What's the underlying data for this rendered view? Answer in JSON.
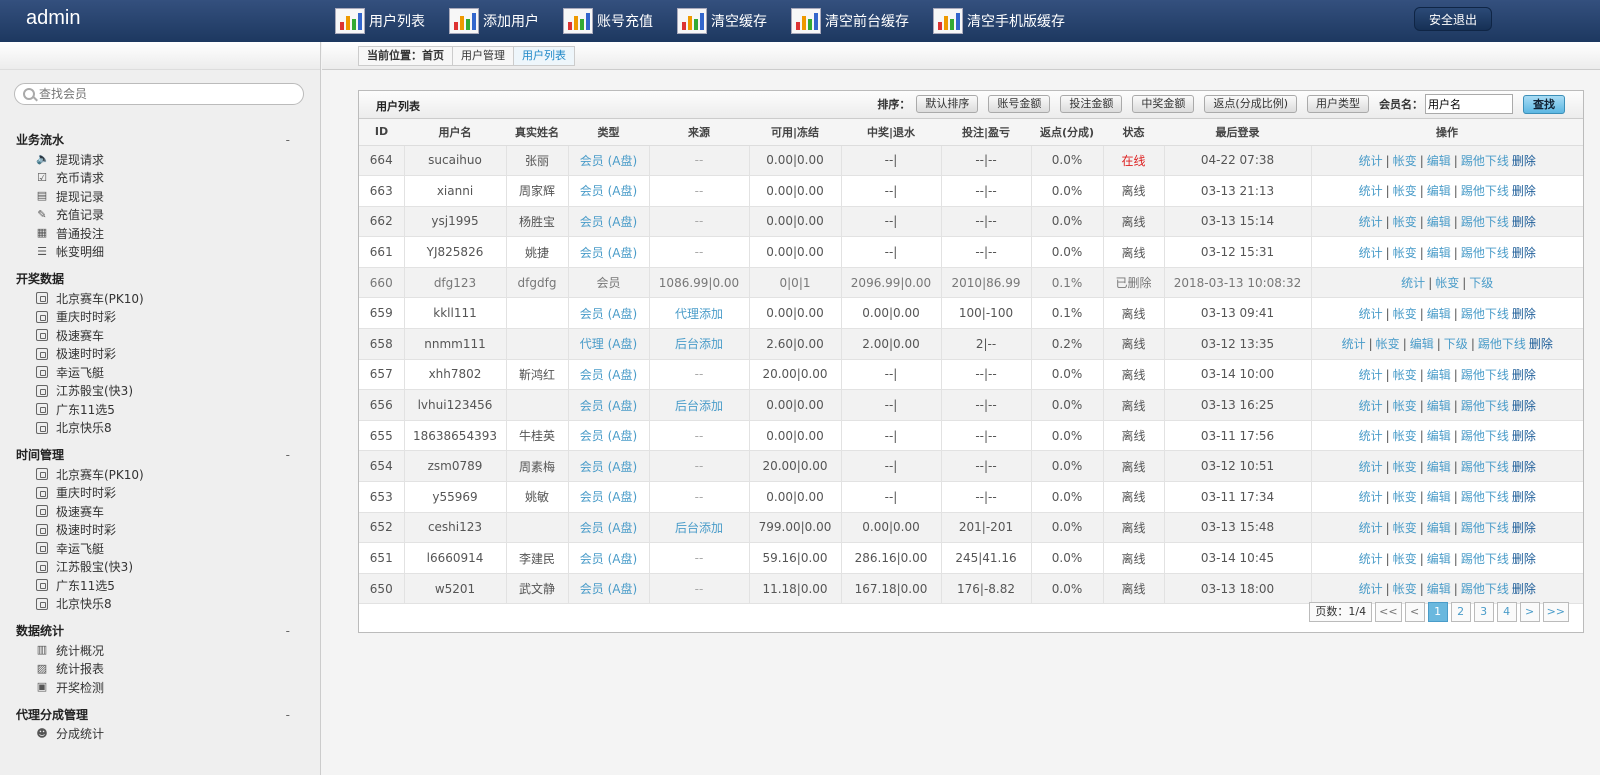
{
  "header": {
    "brand": "admin",
    "nav": [
      "用户列表",
      "添加用户",
      "账号充值",
      "清空缓存",
      "清空前台缓存",
      "清空手机版缓存"
    ],
    "logout": "安全退出"
  },
  "sidebar": {
    "search_placeholder": "查找会员",
    "groups": [
      {
        "title": "业务流水",
        "collapse": "-",
        "items": [
          {
            "label": "提现请求",
            "icon": "speaker-icon"
          },
          {
            "label": "充币请求",
            "icon": "check-icon"
          },
          {
            "label": "提现记录",
            "icon": "wallet-icon"
          },
          {
            "label": "充值记录",
            "icon": "pen-icon"
          },
          {
            "label": "普通投注",
            "icon": "book-icon"
          },
          {
            "label": "帐变明细",
            "icon": "list-icon"
          }
        ]
      },
      {
        "title": "开奖数据",
        "collapse": "",
        "items": [
          {
            "label": "北京赛车(PK10)"
          },
          {
            "label": "重庆时时彩"
          },
          {
            "label": "极速赛车"
          },
          {
            "label": "极速时时彩"
          },
          {
            "label": "幸运飞艇"
          },
          {
            "label": "江苏骰宝(快3)"
          },
          {
            "label": "广东11选5"
          },
          {
            "label": "北京快乐8"
          }
        ]
      },
      {
        "title": "时间管理",
        "collapse": "-",
        "items": [
          {
            "label": "北京赛车(PK10)"
          },
          {
            "label": "重庆时时彩"
          },
          {
            "label": "极速赛车"
          },
          {
            "label": "极速时时彩"
          },
          {
            "label": "幸运飞艇"
          },
          {
            "label": "江苏骰宝(快3)"
          },
          {
            "label": "广东11选5"
          },
          {
            "label": "北京快乐8"
          }
        ]
      },
      {
        "title": "数据统计",
        "collapse": "-",
        "items": [
          {
            "label": "统计概况",
            "icon": "chart-icon"
          },
          {
            "label": "统计报表",
            "icon": "report-icon"
          },
          {
            "label": "开奖检测",
            "icon": "monitor-icon"
          }
        ]
      },
      {
        "title": "代理分成管理",
        "collapse": "-",
        "items": [
          {
            "label": "分成统计",
            "icon": "users-icon"
          }
        ]
      }
    ]
  },
  "breadcrumb": [
    "当前位置：首页",
    "用户管理",
    "用户列表"
  ],
  "panel": {
    "title": "用户列表",
    "sort_label": "排序：",
    "sort_buttons": [
      "默认排序",
      "账号金额",
      "投注金额",
      "中奖金额",
      "返点(分成比例)",
      "用户类型"
    ],
    "member_label": "会员名：",
    "member_value": "用户名",
    "query": "查找"
  },
  "table": {
    "columns": [
      "ID",
      "用户名",
      "真实姓名",
      "类型",
      "来源",
      "可用|冻结",
      "中奖|退水",
      "投注|盈亏",
      "返点(分成)",
      "状态",
      "最后登录",
      "操作"
    ],
    "rows": [
      {
        "id": "664",
        "user": "sucaihuo",
        "name": "张丽",
        "type": "会员 (A盘)",
        "src": "--",
        "bal": "0.00|0.00",
        "win": "--|",
        "bet": "--|--",
        "rebate": "0.0%",
        "status": "在线",
        "login": "04-22 07:38",
        "ops": [
          "统计",
          "帐变",
          "编辑",
          "踢他下线"
        ],
        "del": "删除"
      },
      {
        "id": "663",
        "user": "xianni",
        "name": "周家辉",
        "type": "会员 (A盘)",
        "src": "--",
        "bal": "0.00|0.00",
        "win": "--|",
        "bet": "--|--",
        "rebate": "0.0%",
        "status": "离线",
        "login": "03-13 21:13",
        "ops": [
          "统计",
          "帐变",
          "编辑",
          "踢他下线"
        ],
        "del": "删除"
      },
      {
        "id": "662",
        "user": "ysj1995",
        "name": "杨胜宝",
        "type": "会员 (A盘)",
        "src": "--",
        "bal": "0.00|0.00",
        "win": "--|",
        "bet": "--|--",
        "rebate": "0.0%",
        "status": "离线",
        "login": "03-13 15:14",
        "ops": [
          "统计",
          "帐变",
          "编辑",
          "踢他下线"
        ],
        "del": "删除"
      },
      {
        "id": "661",
        "user": "YJ825826",
        "name": "姚捷",
        "type": "会员 (A盘)",
        "src": "--",
        "bal": "0.00|0.00",
        "win": "--|",
        "bet": "--|--",
        "rebate": "0.0%",
        "status": "离线",
        "login": "03-12 15:31",
        "ops": [
          "统计",
          "帐变",
          "编辑",
          "踢他下线"
        ],
        "del": "删除"
      },
      {
        "id": "660",
        "user": "dfg123",
        "name": "dfgdfg",
        "type": "会员",
        "src": "1086.99|0.00",
        "bal": "0|0|1",
        "win": "2096.99|0.00",
        "bet": "2010|86.99",
        "rebate": "0.1%",
        "status": "已删除",
        "login": "2018-03-13 10:08:32",
        "ops": [
          "统计",
          "帐变",
          "下级"
        ],
        "del": "",
        "deleted": true
      },
      {
        "id": "659",
        "user": "kkll111",
        "name": "",
        "type": "会员 (A盘)",
        "src": "代理添加",
        "bal": "0.00|0.00",
        "win": "0.00|0.00",
        "bet": "100|-100",
        "rebate": "0.1%",
        "status": "离线",
        "login": "03-13 09:41",
        "ops": [
          "统计",
          "帐变",
          "编辑",
          "踢他下线"
        ],
        "del": "删除"
      },
      {
        "id": "658",
        "user": "nnmm111",
        "name": "",
        "type": "代理 (A盘)",
        "src": "后台添加",
        "bal": "2.60|0.00",
        "win": "2.00|0.00",
        "bet": "2|--",
        "rebate": "0.2%",
        "status": "离线",
        "login": "03-12 13:35",
        "ops": [
          "统计",
          "帐变",
          "编辑",
          "下级",
          "踢他下线"
        ],
        "del": "删除"
      },
      {
        "id": "657",
        "user": "xhh7802",
        "name": "靳鸿红",
        "type": "会员 (A盘)",
        "src": "--",
        "bal": "20.00|0.00",
        "win": "--|",
        "bet": "--|--",
        "rebate": "0.0%",
        "status": "离线",
        "login": "03-14 10:00",
        "ops": [
          "统计",
          "帐变",
          "编辑",
          "踢他下线"
        ],
        "del": "删除"
      },
      {
        "id": "656",
        "user": "lvhui123456",
        "name": "",
        "type": "会员 (A盘)",
        "src": "后台添加",
        "bal": "0.00|0.00",
        "win": "--|",
        "bet": "--|--",
        "rebate": "0.0%",
        "status": "离线",
        "login": "03-13 16:25",
        "ops": [
          "统计",
          "帐变",
          "编辑",
          "踢他下线"
        ],
        "del": "删除"
      },
      {
        "id": "655",
        "user": "18638654393",
        "name": "牛桂英",
        "type": "会员 (A盘)",
        "src": "--",
        "bal": "0.00|0.00",
        "win": "--|",
        "bet": "--|--",
        "rebate": "0.0%",
        "status": "离线",
        "login": "03-11 17:56",
        "ops": [
          "统计",
          "帐变",
          "编辑",
          "踢他下线"
        ],
        "del": "删除"
      },
      {
        "id": "654",
        "user": "zsm0789",
        "name": "周素梅",
        "type": "会员 (A盘)",
        "src": "--",
        "bal": "20.00|0.00",
        "win": "--|",
        "bet": "--|--",
        "rebate": "0.0%",
        "status": "离线",
        "login": "03-12 10:51",
        "ops": [
          "统计",
          "帐变",
          "编辑",
          "踢他下线"
        ],
        "del": "删除"
      },
      {
        "id": "653",
        "user": "y55969",
        "name": "姚敏",
        "type": "会员 (A盘)",
        "src": "--",
        "bal": "0.00|0.00",
        "win": "--|",
        "bet": "--|--",
        "rebate": "0.0%",
        "status": "离线",
        "login": "03-11 17:34",
        "ops": [
          "统计",
          "帐变",
          "编辑",
          "踢他下线"
        ],
        "del": "删除"
      },
      {
        "id": "652",
        "user": "ceshi123",
        "name": "",
        "type": "会员 (A盘)",
        "src": "后台添加",
        "bal": "799.00|0.00",
        "win": "0.00|0.00",
        "bet": "201|-201",
        "rebate": "0.0%",
        "status": "离线",
        "login": "03-13 15:48",
        "ops": [
          "统计",
          "帐变",
          "编辑",
          "踢他下线"
        ],
        "del": "删除"
      },
      {
        "id": "651",
        "user": "l6660914",
        "name": "李建民",
        "type": "会员 (A盘)",
        "src": "--",
        "bal": "59.16|0.00",
        "win": "286.16|0.00",
        "bet": "245|41.16",
        "rebate": "0.0%",
        "status": "离线",
        "login": "03-14 10:45",
        "ops": [
          "统计",
          "帐变",
          "编辑",
          "踢他下线"
        ],
        "del": "删除"
      },
      {
        "id": "650",
        "user": "w5201",
        "name": "武文静",
        "type": "会员 (A盘)",
        "src": "--",
        "bal": "11.18|0.00",
        "win": "167.18|0.00",
        "bet": "176|-8.82",
        "rebate": "0.0%",
        "status": "离线",
        "login": "03-13 18:00",
        "ops": [
          "统计",
          "帐变",
          "编辑",
          "踢他下线"
        ],
        "del": "删除"
      }
    ]
  },
  "pager": {
    "info": "页数：1/4",
    "first": "<<",
    "prev": "<",
    "pages": [
      "1",
      "2",
      "3",
      "4"
    ],
    "next": ">",
    "last": ">>",
    "current": "1"
  },
  "colors": {
    "header": "#2a4572",
    "link": "#4a9cc9",
    "online": "#dd2222"
  }
}
